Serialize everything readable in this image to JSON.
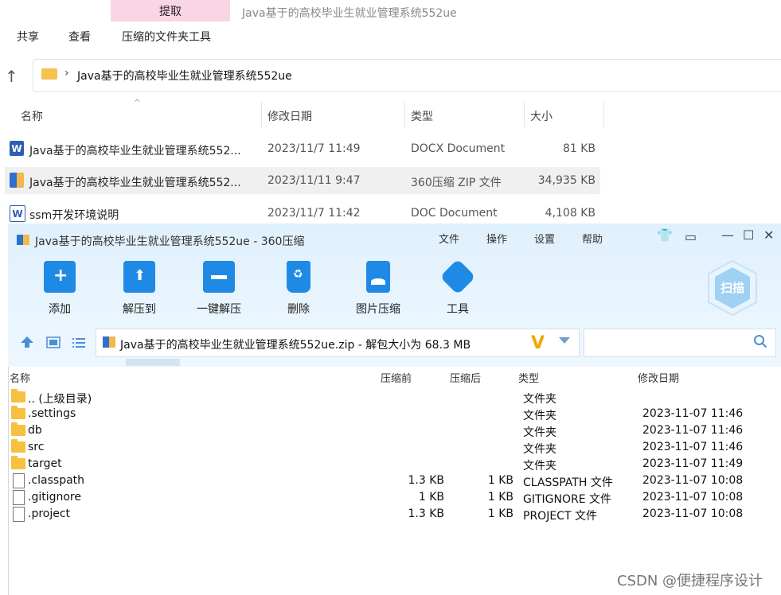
{
  "explorer": {
    "extract_tab": "提取",
    "window_title": "Java基于的高校毕业生就业管理系统552ue",
    "ribbon_tabs": [
      "共享",
      "查看",
      "压缩的文件夹工具"
    ],
    "address_path": "Java基于的高校毕业生就业管理系统552ue",
    "columns": {
      "name": "名称",
      "date": "修改日期",
      "type": "类型",
      "size": "大小"
    },
    "files": [
      {
        "name": "Java基于的高校毕业生就业管理系统552...",
        "date": "2023/11/7 11:49",
        "type": "DOCX Document",
        "size": "81 KB",
        "icon": "word-icon",
        "icon_text": "W"
      },
      {
        "name": "Java基于的高校毕业生就业管理系统552...",
        "date": "2023/11/11 9:47",
        "type": "360压缩 ZIP 文件",
        "size": "34,935 KB",
        "icon": "zip-icon",
        "icon_text": ""
      },
      {
        "name": "ssm开发环境说明",
        "date": "2023/11/7 11:42",
        "type": "DOC Document",
        "size": "4,108 KB",
        "icon": "word-icon",
        "icon_text": "W"
      }
    ]
  },
  "zip360": {
    "title": "Java基于的高校毕业生就业管理系统552ue - 360压缩",
    "menus": [
      "文件",
      "操作",
      "设置",
      "帮助"
    ],
    "toolbar": [
      "添加",
      "解压到",
      "一键解压",
      "删除",
      "图片压缩",
      "工具"
    ],
    "scan_label": "扫描",
    "path_text": "Java基于的高校毕业生就业管理系统552ue.zip - 解包大小为 68.3 MB",
    "columns": {
      "name": "名称",
      "before": "压缩前",
      "after": "压缩后",
      "type": "类型",
      "date": "修改日期"
    },
    "entries": [
      {
        "name": ".. (上级目录)",
        "before": "",
        "after": "",
        "type": "文件夹",
        "date": "",
        "kind": "folder"
      },
      {
        "name": ".settings",
        "before": "",
        "after": "",
        "type": "文件夹",
        "date": "2023-11-07 11:46",
        "kind": "folder"
      },
      {
        "name": "db",
        "before": "",
        "after": "",
        "type": "文件夹",
        "date": "2023-11-07 11:46",
        "kind": "folder"
      },
      {
        "name": "src",
        "before": "",
        "after": "",
        "type": "文件夹",
        "date": "2023-11-07 11:46",
        "kind": "folder"
      },
      {
        "name": "target",
        "before": "",
        "after": "",
        "type": "文件夹",
        "date": "2023-11-07 11:49",
        "kind": "folder"
      },
      {
        "name": ".classpath",
        "before": "1.3 KB",
        "after": "1 KB",
        "type": "CLASSPATH 文件",
        "date": "2023-11-07 10:08",
        "kind": "file"
      },
      {
        "name": ".gitignore",
        "before": "1 KB",
        "after": "1 KB",
        "type": "GITIGNORE 文件",
        "date": "2023-11-07 10:08",
        "kind": "file"
      },
      {
        "name": ".project",
        "before": "1.3 KB",
        "after": "1 KB",
        "type": "PROJECT 文件",
        "date": "2023-11-07 10:08",
        "kind": "file"
      }
    ]
  },
  "watermark": "CSDN @便捷程序设计"
}
